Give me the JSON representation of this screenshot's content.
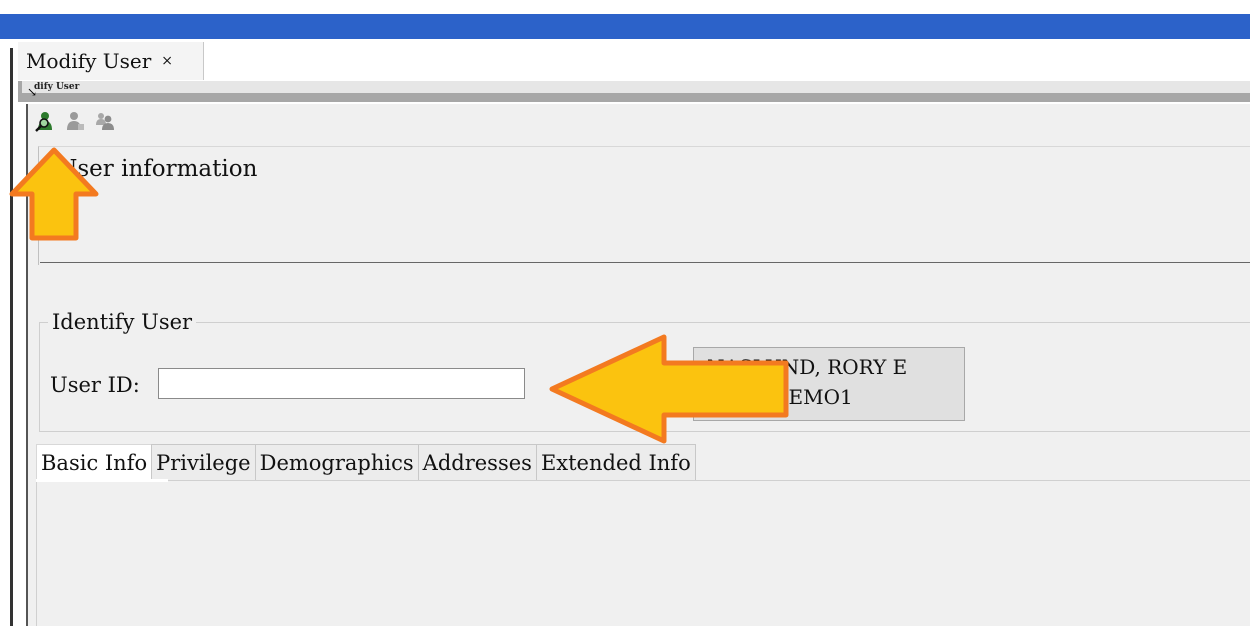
{
  "tab": {
    "title": "Modify User",
    "close_symbol": "×"
  },
  "strip": {
    "title": "dify User"
  },
  "toolbar": [
    {
      "name": "search-user-icon"
    },
    {
      "name": "user-icon"
    },
    {
      "name": "users-icon"
    }
  ],
  "section": {
    "title": "User information"
  },
  "identify": {
    "legend": "Identify User",
    "user_id_label": "User ID:",
    "user_id_value": ""
  },
  "result": {
    "name": "NASLUND, RORY E",
    "id": "NDEMO1"
  },
  "tabs": [
    {
      "label": "Basic Info",
      "active": true
    },
    {
      "label": "Privilege"
    },
    {
      "label": "Demographics"
    },
    {
      "label": "Addresses"
    },
    {
      "label": "Extended Info"
    }
  ],
  "colors": {
    "top_bar": "#2c62c9",
    "annotation_arrow": "#fbc30f",
    "annotation_outline": "#f37a20"
  }
}
